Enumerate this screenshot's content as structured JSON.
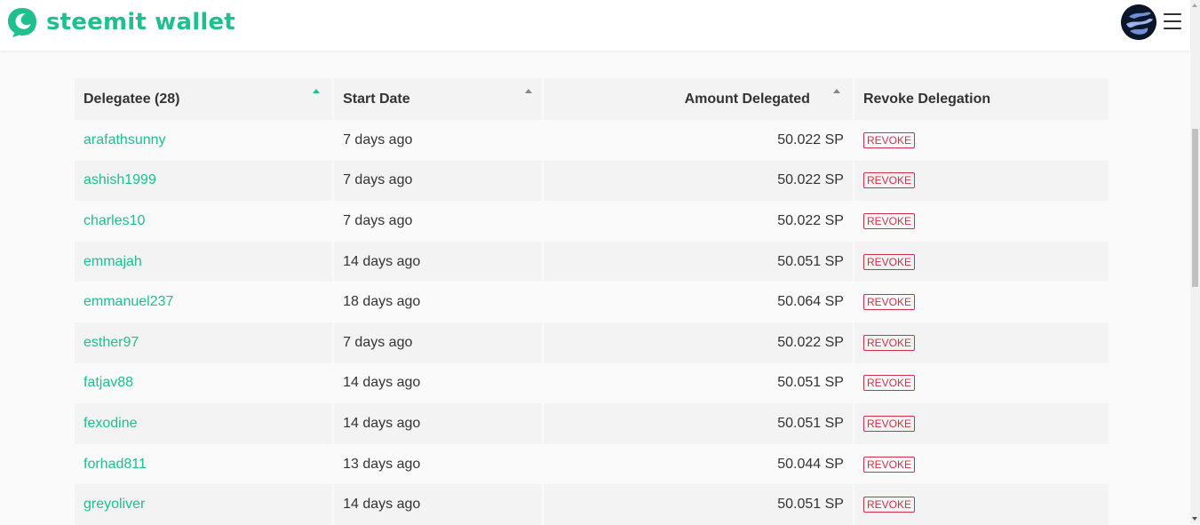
{
  "header": {
    "logo_text": "steemit wallet",
    "brand_color": "#1fbf8f",
    "logo_icon": "steemit-logo-icon",
    "avatar_icon": "user-avatar",
    "menu_icon": "hamburger-menu-icon"
  },
  "table": {
    "columns": [
      {
        "label": "Delegatee (28)",
        "sort": "ascending"
      },
      {
        "label": "Start Date",
        "sort": "sortable"
      },
      {
        "label": "Amount Delegated",
        "sort": "sortable"
      },
      {
        "label": "Revoke Delegation"
      }
    ],
    "revoke_label": "REVOKE",
    "rows": [
      {
        "delegatee": "arafathsunny",
        "start": "7 days ago",
        "amount": "50.022 SP"
      },
      {
        "delegatee": "ashish1999",
        "start": "7 days ago",
        "amount": "50.022 SP"
      },
      {
        "delegatee": "charles10",
        "start": "7 days ago",
        "amount": "50.022 SP"
      },
      {
        "delegatee": "emmajah",
        "start": "14 days ago",
        "amount": "50.051 SP"
      },
      {
        "delegatee": "emmanuel237",
        "start": "18 days ago",
        "amount": "50.064 SP"
      },
      {
        "delegatee": "esther97",
        "start": "7 days ago",
        "amount": "50.022 SP"
      },
      {
        "delegatee": "fatjav88",
        "start": "14 days ago",
        "amount": "50.051 SP"
      },
      {
        "delegatee": "fexodine",
        "start": "14 days ago",
        "amount": "50.051 SP"
      },
      {
        "delegatee": "forhad811",
        "start": "13 days ago",
        "amount": "50.044 SP"
      },
      {
        "delegatee": "greyoliver",
        "start": "14 days ago",
        "amount": "50.051 SP"
      }
    ]
  },
  "colors": {
    "accent": "#1fbf8f",
    "revoke": "#d1304b"
  }
}
